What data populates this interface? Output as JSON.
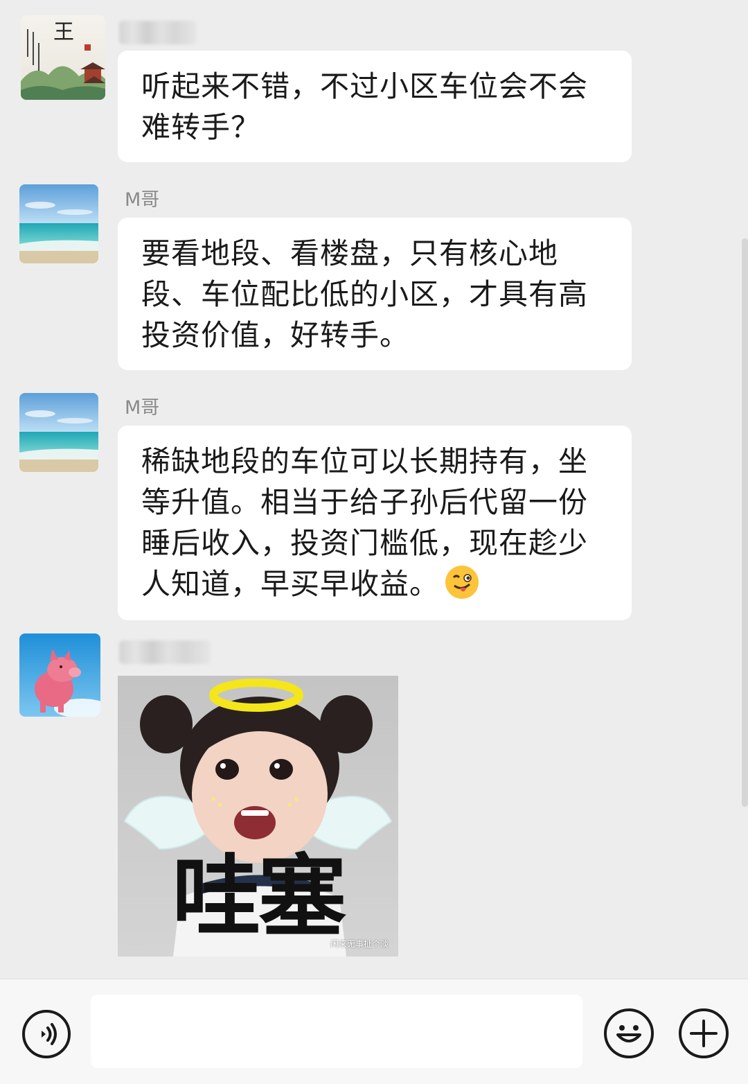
{
  "chat": {
    "messages": [
      {
        "sender": "",
        "avatar_icon": "landscape-pavilion-avatar",
        "avatar_character": "王",
        "text": "听起来不错，不过小区车位会不会难转手？"
      },
      {
        "sender": "M哥",
        "avatar_icon": "beach-avatar",
        "text": "要看地段、看楼盘，只有核心地段、车位配比低的小区，才具有高投资价值，好转手。"
      },
      {
        "sender": "M哥",
        "avatar_icon": "beach-avatar",
        "text": "稀缺地段的车位可以长期持有，坐等升值。相当于给子孙后代留一份睡后收入，投资门槛低，现在趁少人知道，早买早收益。",
        "emoji": "wink-tongue-emoji"
      },
      {
        "sender": "",
        "avatar_icon": "pink-pig-avatar",
        "sticker": {
          "caption": "哇塞",
          "watermark": "闲来无事扯个淡"
        }
      }
    ]
  },
  "input_bar": {
    "voice_icon": "voice-icon",
    "text_value": "",
    "emoji_icon": "emoji-icon",
    "plus_icon": "plus-icon"
  },
  "colors": {
    "background": "#ededed",
    "bubble": "#ffffff",
    "text": "#1a1a1a",
    "sender": "#8a8a8a"
  }
}
